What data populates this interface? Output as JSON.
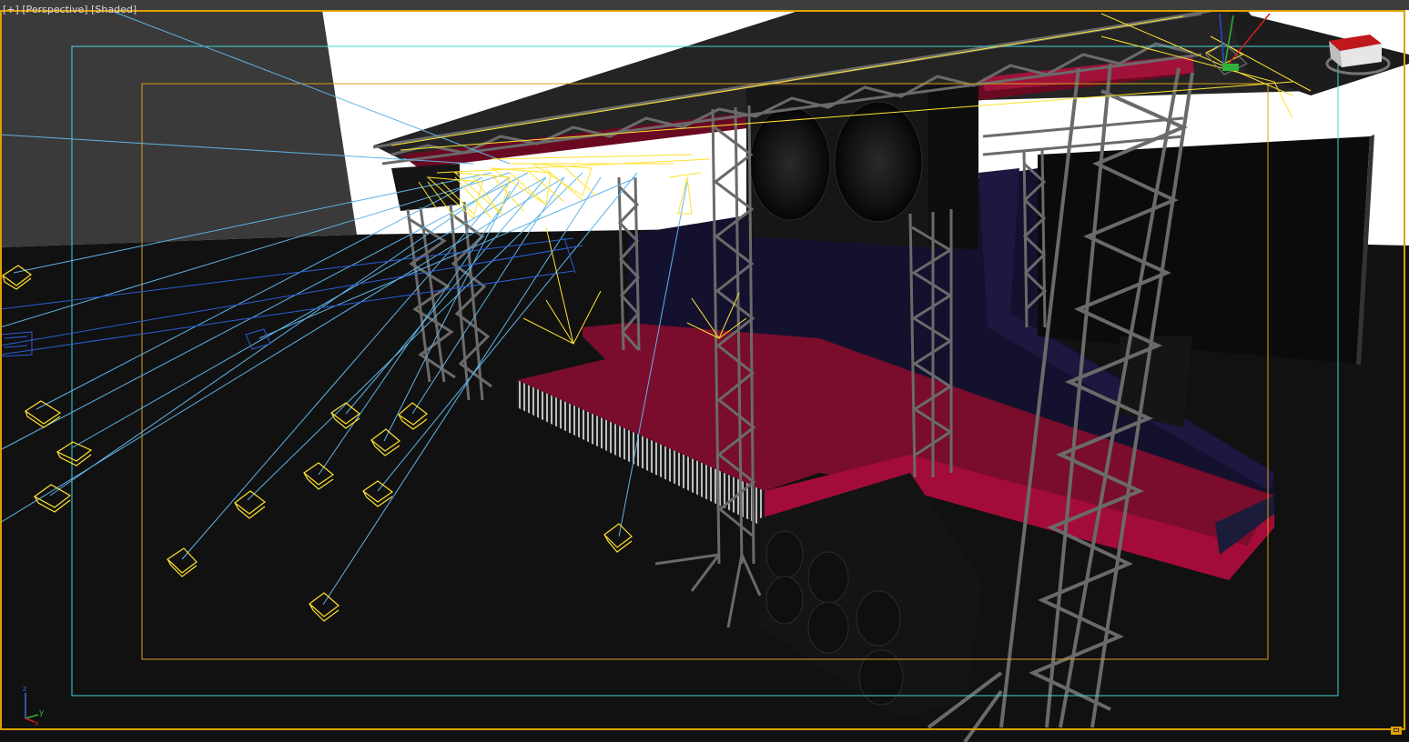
{
  "viewport": {
    "label_parts": [
      "[+]",
      "[Perspective]",
      "[Shaded]"
    ],
    "projection": "Perspective",
    "shading": "Shaded"
  },
  "axis_tripod": {
    "x_label": "x",
    "y_label": "y",
    "z_label": "z"
  },
  "colors": {
    "ui_background": "#3d3d3d",
    "active_border": "#e0a000",
    "safe_frame_outer": "#44d4dc",
    "safe_frame_inner": "#d9a020",
    "sky": "#ffffff",
    "wall": "#3a3a3a",
    "floor": "#111111",
    "stage_top": "#7a0d2c",
    "stage_side": "#a30c38",
    "backdrop": "#14112e",
    "truss": "#6a6a6a",
    "light_gizmo": "#ffe22e",
    "target_line": "#5fb3e6",
    "selected_object": "#2c5ed8",
    "speaker": "#1a1a1a"
  },
  "icons": {
    "viewcube": "viewcube-icon",
    "axis": "axis-tripod-icon",
    "maximize": "maximize-viewport-icon"
  }
}
